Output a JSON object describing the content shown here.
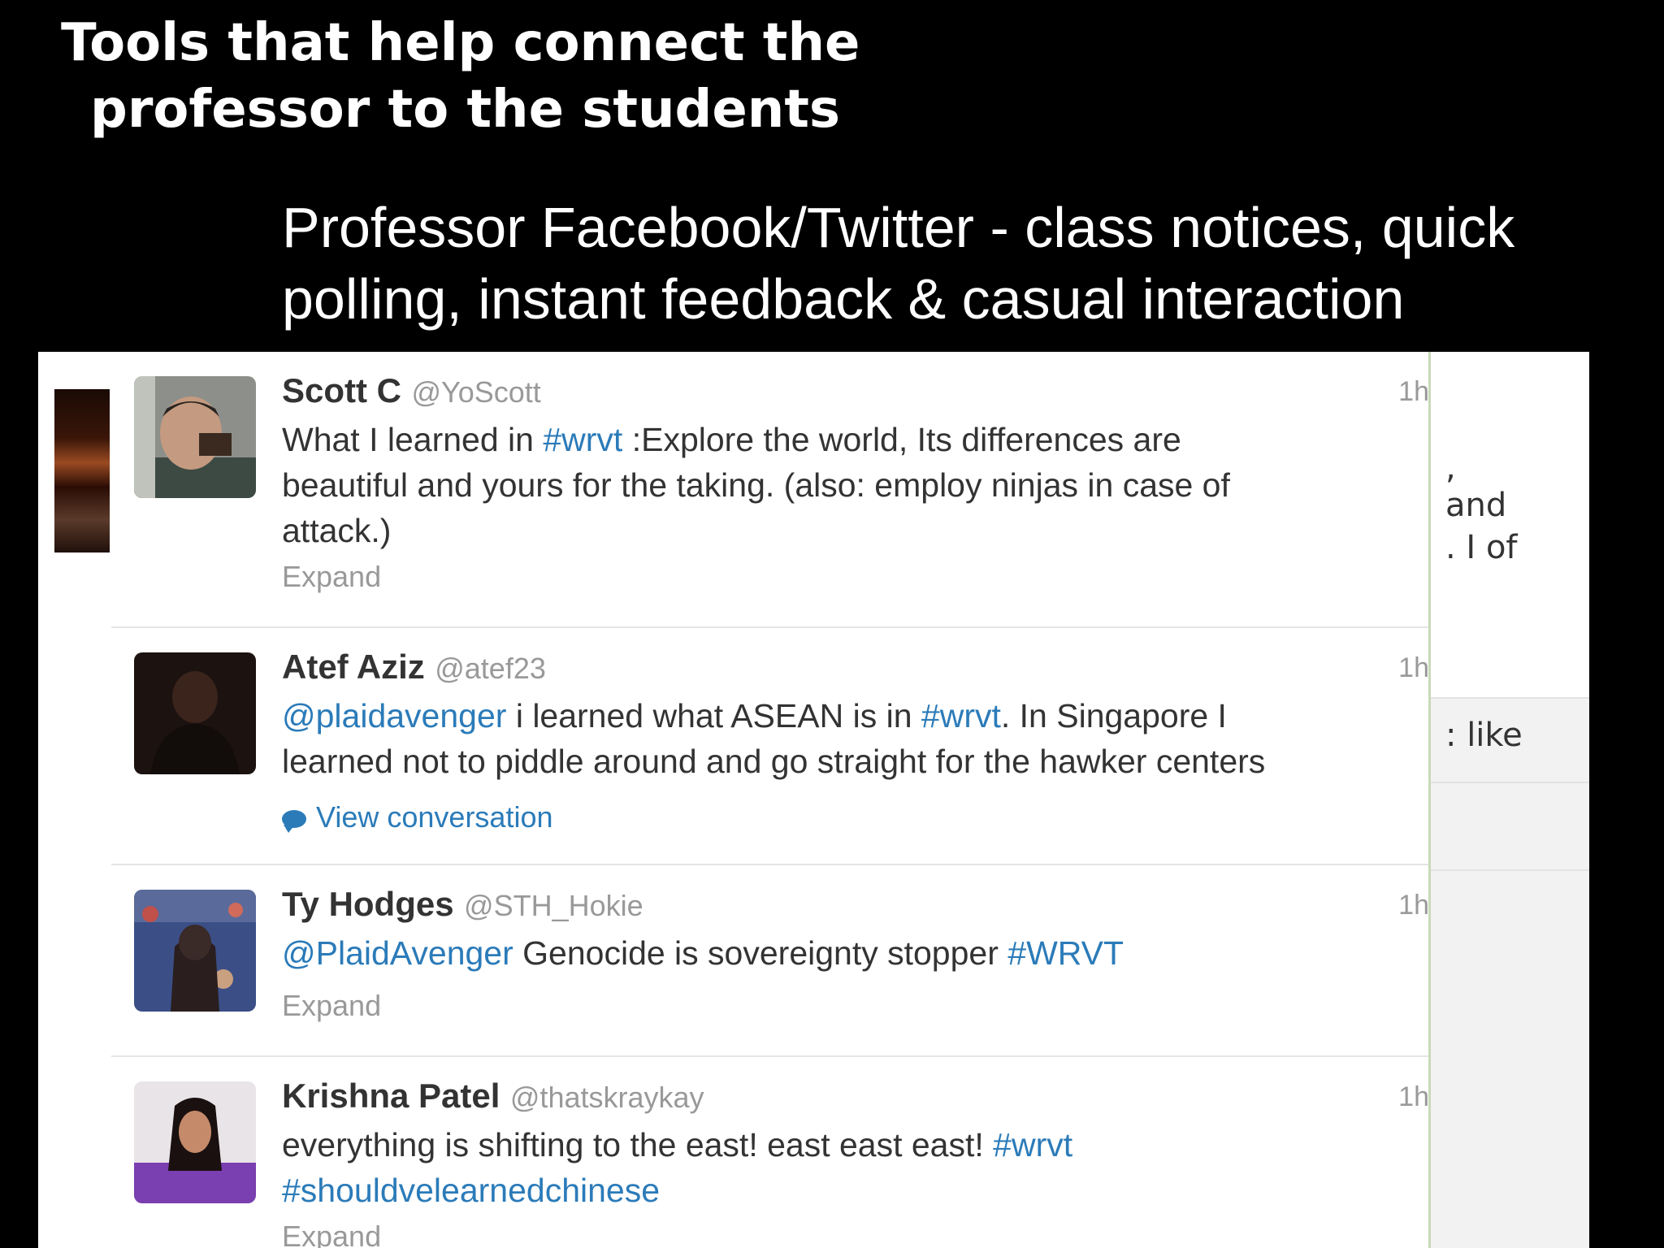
{
  "slide": {
    "title_lines": [
      "Tools that help connect the",
      "professor to the students"
    ],
    "subtitle_lines": [
      "Professor Facebook/Twitter - class notices, quick",
      "polling, instant feedback & casual interaction"
    ]
  },
  "tweets": [
    {
      "name": "Scott C",
      "handle": "@YoScott",
      "time": "1h",
      "lines": [
        [
          {
            "t": "What I learned in "
          },
          {
            "t": "#wrvt",
            "link": true
          },
          {
            "t": " :Explore the world, Its differences are"
          }
        ],
        [
          {
            "t": "beautiful and yours for the taking. (also: employ ninjas in case of"
          }
        ],
        [
          {
            "t": "attack.)"
          }
        ]
      ],
      "action": "Expand"
    },
    {
      "name": "Atef Aziz",
      "handle": "@atef23",
      "time": "1h",
      "lines": [
        [
          {
            "t": "@plaidavenger",
            "link": true
          },
          {
            "t": " i learned what ASEAN is in "
          },
          {
            "t": "#wrvt",
            "link": true
          },
          {
            "t": ". In Singapore I"
          }
        ],
        [
          {
            "t": "learned not to piddle around and go straight for the hawker centers"
          }
        ]
      ],
      "action": "View conversation"
    },
    {
      "name": "Ty Hodges",
      "handle": "@STH_Hokie",
      "time": "1h",
      "lines": [
        [
          {
            "t": "@PlaidAvenger",
            "link": true
          },
          {
            "t": " Genocide is sovereignty stopper "
          },
          {
            "t": "#WRVT",
            "link": true
          }
        ]
      ],
      "action": "Expand"
    },
    {
      "name": "Krishna Patel",
      "handle": "@thatskraykay",
      "time": "1h",
      "lines": [
        [
          {
            "t": "everything is shifting to the east! east east east! "
          },
          {
            "t": "#wrvt",
            "link": true
          }
        ],
        [
          {
            "t": "#shouldvelearnedchinese",
            "link": true
          }
        ]
      ],
      "action": "Expand"
    }
  ],
  "right_panel": {
    "fragments": [
      ",",
      "and",
      ". I of",
      ": like"
    ]
  },
  "colors": {
    "link": "#2b7bb9",
    "name": "#333333",
    "meta": "#999999",
    "slide_bg": "#000000"
  }
}
